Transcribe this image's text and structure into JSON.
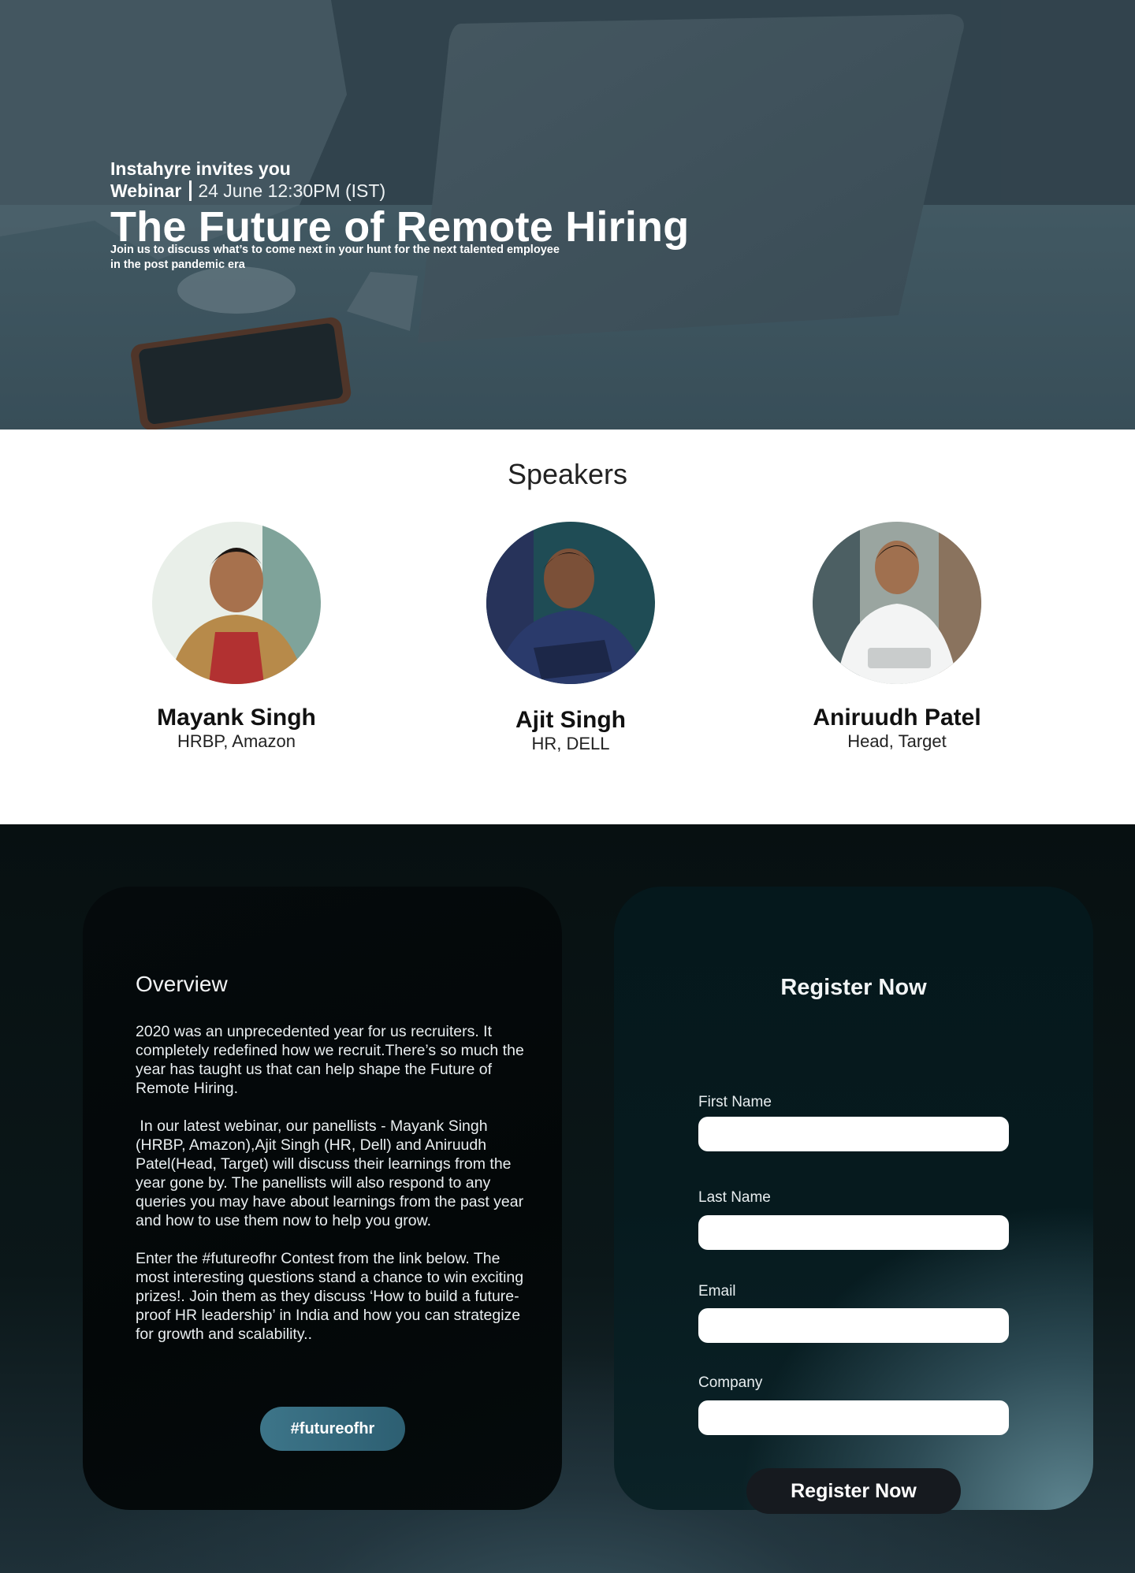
{
  "hero": {
    "invite": "Instahyre invites you",
    "event_kind": "Webinar",
    "event_date": "24 June 12:30PM (IST)",
    "title": "The Future of Remote Hiring",
    "subtitle": "Join us to discuss what’s to come next in your hunt for the next talented employee in the post pandemic era"
  },
  "speakers": {
    "title": "Speakers",
    "items": [
      {
        "name": "Mayank Singh",
        "role": "HRBP, Amazon"
      },
      {
        "name": "Ajit Singh",
        "role": "HR, DELL"
      },
      {
        "name": "Aniruudh Patel",
        "role": "Head, Target"
      }
    ]
  },
  "overview": {
    "title": "Overview",
    "paragraphs": [
      "2020 was an unprecedented year for us recruiters. It completely redefined how we recruit.There’s so much the year has taught us that can help shape the Future of Remote Hiring.",
      " In our latest webinar, our panellists - Mayank Singh (HRBP, Amazon),Ajit Singh (HR, Dell) and Aniruudh Patel(Head, Target) will discuss their learnings from the year gone by. The panellists will also respond to any queries you may have about learnings from the past year and how to use them now to help you grow.",
      "Enter the #futureofhr Contest from the link below. The most interesting questions stand a chance to win exciting prizes!. Join them as they discuss ‘How to build a future-proof HR leadership’ in India and how you can strategize for growth and scalability.."
    ],
    "button_label": "#futureofhr"
  },
  "register": {
    "title": "Register Now",
    "fields": [
      {
        "label": "First Name",
        "value": ""
      },
      {
        "label": "Last Name",
        "value": ""
      },
      {
        "label": "Email",
        "value": ""
      },
      {
        "label": "Company",
        "value": ""
      }
    ],
    "button_label": "Register Now"
  },
  "colors": {
    "hero_bg": "#3f525c",
    "tag_button": "#3d7589",
    "register_button": "#161a1f",
    "dark_panel": "#030708"
  }
}
